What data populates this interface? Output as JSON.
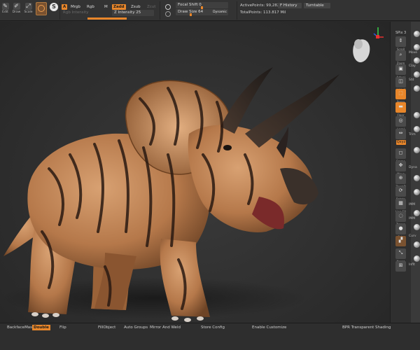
{
  "toolbar": {
    "tools": [
      {
        "name": "Edit",
        "icon": "edit-icon"
      },
      {
        "name": "Draw",
        "icon": "draw-icon"
      },
      {
        "name": "Scale",
        "icon": "scale-icon"
      }
    ],
    "a_label": "A",
    "mrgb": "Mrgb",
    "rgb": "Rgb",
    "m": "M",
    "rgb_intensity_label": "Rgb Intensity",
    "zadd": "Zadd",
    "zsub": "Zsub",
    "zcut": "Zcut",
    "z_intensity": "Z Intensity 25",
    "focal_shift": "Focal Shift 0",
    "draw_size": "Draw Size 64",
    "dynamic": "Dynamic",
    "active_points": "ActivePoints: 99,282 Mil",
    "total_points": "TotalPoints: 113.817 Mil",
    "history": "F History",
    "turntable": "Turntable"
  },
  "shelf": {
    "spix": "SPix 3",
    "buttons": [
      {
        "label": "Scroll",
        "icon": "scroll-icon"
      },
      {
        "label": "Zoom",
        "icon": "zoom-icon"
      },
      {
        "label": "Actual",
        "icon": "actual-icon"
      },
      {
        "label": "AAHalf",
        "icon": "aahalf-icon"
      },
      {
        "label": "Persp",
        "icon": "persp-icon"
      },
      {
        "label": "Floor",
        "icon": "floor-icon"
      },
      {
        "label": "Local",
        "icon": "local-icon"
      },
      {
        "label": "L.Sym",
        "icon": "sym-icon"
      },
      {
        "label": "Frame",
        "icon": "frame-icon"
      },
      {
        "label": "Move",
        "icon": "move-icon"
      },
      {
        "label": "ZoomD",
        "icon": "zoomd-icon"
      },
      {
        "label": "Rotate",
        "icon": "rotate-icon"
      },
      {
        "label": "Line Fill",
        "icon": "linefill-icon"
      },
      {
        "label": "Transp",
        "icon": "transp-icon"
      },
      {
        "label": "Solo",
        "icon": "solo-icon"
      },
      {
        "label": "Xpose",
        "icon": "xpose-icon"
      }
    ],
    "xyz": "Qxyz",
    "spheres": [
      "Dyna",
      "Move",
      "Clay",
      "Std",
      "Trim",
      "IMM",
      "IMM",
      "Curv",
      "Inflt"
    ]
  },
  "bottom": {
    "backface_mask": "BackfaceMask",
    "double": "Double",
    "flip": "Flip",
    "fill_object": "FillObject",
    "auto_groups": "Auto Groups",
    "mirror_weld": "Mirror And Weld",
    "store_config": "Store Config",
    "enable_customize": "Enable Customize",
    "bpr_shading": "BPR Transparent Shading"
  },
  "colors": {
    "accent": "#e8862a",
    "panel": "#333333",
    "viewport": "#2c2c2c"
  }
}
